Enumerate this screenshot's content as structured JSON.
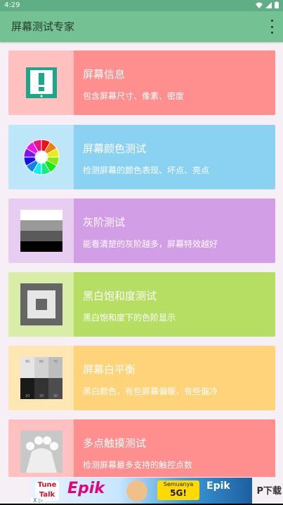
{
  "status_bar": {
    "time": "4:29",
    "icons": [
      "wifi-icon",
      "signal-icon",
      "battery-icon"
    ]
  },
  "app_bar": {
    "title": "屏幕测试专家",
    "menu_icon": "more-vert-icon"
  },
  "items": [
    {
      "title": "屏幕信息",
      "subtitle": "包含屏幕尺寸、像素、密度",
      "color": "#ff8e8e",
      "thumb_bg": "#ffc0c0",
      "icon": "screen-info-icon"
    },
    {
      "title": "屏幕颜色测试",
      "subtitle": "检测屏幕的颜色表现、坏点、亮点",
      "color": "#8bd1f2",
      "thumb_bg": "#bde6f9",
      "icon": "color-wheel-icon"
    },
    {
      "title": "灰阶测试",
      "subtitle": "能看清楚的灰阶越多，屏幕特效越好",
      "color": "#d29fe6",
      "thumb_bg": "#e8cdf2",
      "icon": "grayscale-icon"
    },
    {
      "title": "黑白饱和度测试",
      "subtitle": "黑白饱和度下的色阶显示",
      "color": "#b6de63",
      "thumb_bg": "#d8eea6",
      "icon": "saturation-icon"
    },
    {
      "title": "屏幕白平衡",
      "subtitle": "黑白颜色，有些屏幕偏暖，有些偏冷",
      "color": "#ffd37a",
      "thumb_bg": "#ffe7b4",
      "icon": "white-balance-icon",
      "swatch_labels_top": [
        "90",
        "80",
        "70"
      ],
      "swatch_labels_bottom": [
        "10",
        "20",
        "30"
      ]
    },
    {
      "title": "多点触摸测试",
      "subtitle": "检测屏幕最多支持的触控点数",
      "color": "#ff8e8e",
      "thumb_bg": "#ffc0c0",
      "icon": "multi-touch-icon"
    }
  ],
  "ad": {
    "logo_top": "Tune",
    "logo_bottom": "Talk",
    "brand": "Epik",
    "promo_line1": "Semuanya",
    "promo_line2": "5G!",
    "partner": "Epik",
    "choices_label": "X ▷"
  },
  "watermark": "P下载"
}
